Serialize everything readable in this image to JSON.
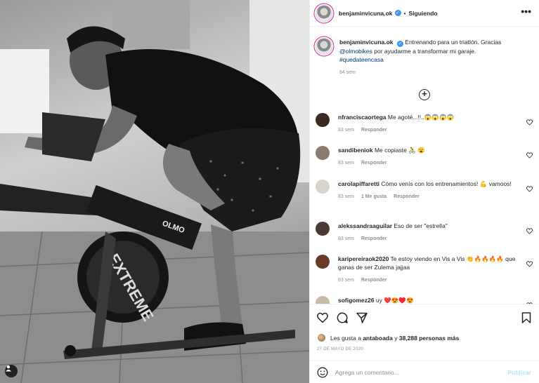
{
  "post": {
    "username": "benjaminvicuna.ok",
    "verified_mark": "✓",
    "separator": "•",
    "follow_status": "Siguiendo",
    "more_label": "•••",
    "caption": {
      "username": "benjaminvicuna.ok",
      "text_1": "Entrenando para un triatlón. Gracias",
      "mention": "@olmobikes",
      "text_2": "por ayudarme a transformar mi garaje.",
      "hashtag": "#quedateencasa",
      "time": "84 sem"
    },
    "load_more_label": "+"
  },
  "comments": [
    {
      "username": "nfranciscaortega",
      "text": "Me agoté...!!..😱😱😱😱",
      "time": "83 sem",
      "likes": "",
      "reply": "Responder",
      "avatar_color": "#3a2a22"
    },
    {
      "username": "sandibeniok",
      "text": "Me copiaste 🚴 😮",
      "time": "83 sem",
      "likes": "",
      "reply": "Responder",
      "avatar_color": "#8a7a70"
    },
    {
      "username": "carolapiffaretti",
      "text": "Cómo venís con los entrenamientos! 💪 vamoos!",
      "time": "83 sem",
      "likes": "1 Me gusta",
      "reply": "Responder",
      "avatar_color": "#d9d4cc"
    },
    {
      "username": "alekssandraaguilar",
      "text": "Eso de ser \"estrella\"",
      "time": "83 sem",
      "likes": "",
      "reply": "Responder",
      "avatar_color": "#4a3a34"
    },
    {
      "username": "karipereiraok2020",
      "text": "Te estoy viendo en Vis a Vis 👏🔥🔥🔥🔥 que ganas de ser Zulema jajjaa",
      "time": "83 sem",
      "likes": "",
      "reply": "Responder",
      "avatar_color": "#6a3a28"
    },
    {
      "username": "sofigomez26",
      "text": "uy ❤️😍♥️😍",
      "time": "",
      "likes": "",
      "reply": "",
      "avatar_color": "#c8b8a8"
    }
  ],
  "actions": {
    "likes_prefix": "Les gusta a",
    "likes_user": "antaboada",
    "likes_mid": "y",
    "likes_count": "38,288 personas más",
    "date": "27 DE MAYO DE 2020"
  },
  "add_comment": {
    "placeholder": "Agrega un comentario...",
    "publish": "Publicar"
  },
  "photo": {
    "bike_brand": "OLMO",
    "wheel_text": "EXTREME"
  }
}
